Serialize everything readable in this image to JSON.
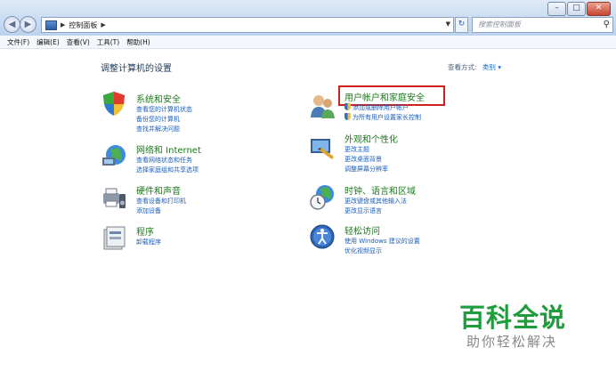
{
  "window_buttons": [
    "–",
    "□",
    "✕"
  ],
  "address": {
    "crumb": "控制面板",
    "search_placeholder": "搜索控制面板"
  },
  "menu": [
    "文件(F)",
    "编辑(E)",
    "查看(V)",
    "工具(T)",
    "帮助(H)"
  ],
  "heading": "调整计算机的设置",
  "view_by": {
    "label": "查看方式:",
    "value": "类别 ▾"
  },
  "categories_left": [
    {
      "title": "系统和安全",
      "links": [
        "查看您的计算机状态",
        "备份您的计算机",
        "查找并解决问题"
      ]
    },
    {
      "title": "网络和 Internet",
      "links": [
        "查看网络状态和任务",
        "选择家庭组和共享选项"
      ]
    },
    {
      "title": "硬件和声音",
      "links": [
        "查看设备和打印机",
        "添加设备"
      ]
    },
    {
      "title": "程序",
      "links": [
        "卸载程序"
      ]
    }
  ],
  "categories_right": [
    {
      "title": "用户帐户和家庭安全",
      "links": [
        "添加或删除用户帐户",
        "为所有用户设置家长控制"
      ]
    },
    {
      "title": "外观和个性化",
      "links": [
        "更改主题",
        "更改桌面背景",
        "调整屏幕分辨率"
      ]
    },
    {
      "title": "时钟、语言和区域",
      "links": [
        "更改键盘或其他输入法",
        "更改显示语言"
      ]
    },
    {
      "title": "轻松访问",
      "links": [
        "使用 Windows 建议的设置",
        "优化视频显示"
      ]
    }
  ],
  "watermark": {
    "title": "百科全说",
    "subtitle": "助你轻松解决"
  },
  "colors": {
    "highlight": "#d0201e",
    "link": "#1a5dbb",
    "title_green": "#1c7a1c"
  }
}
